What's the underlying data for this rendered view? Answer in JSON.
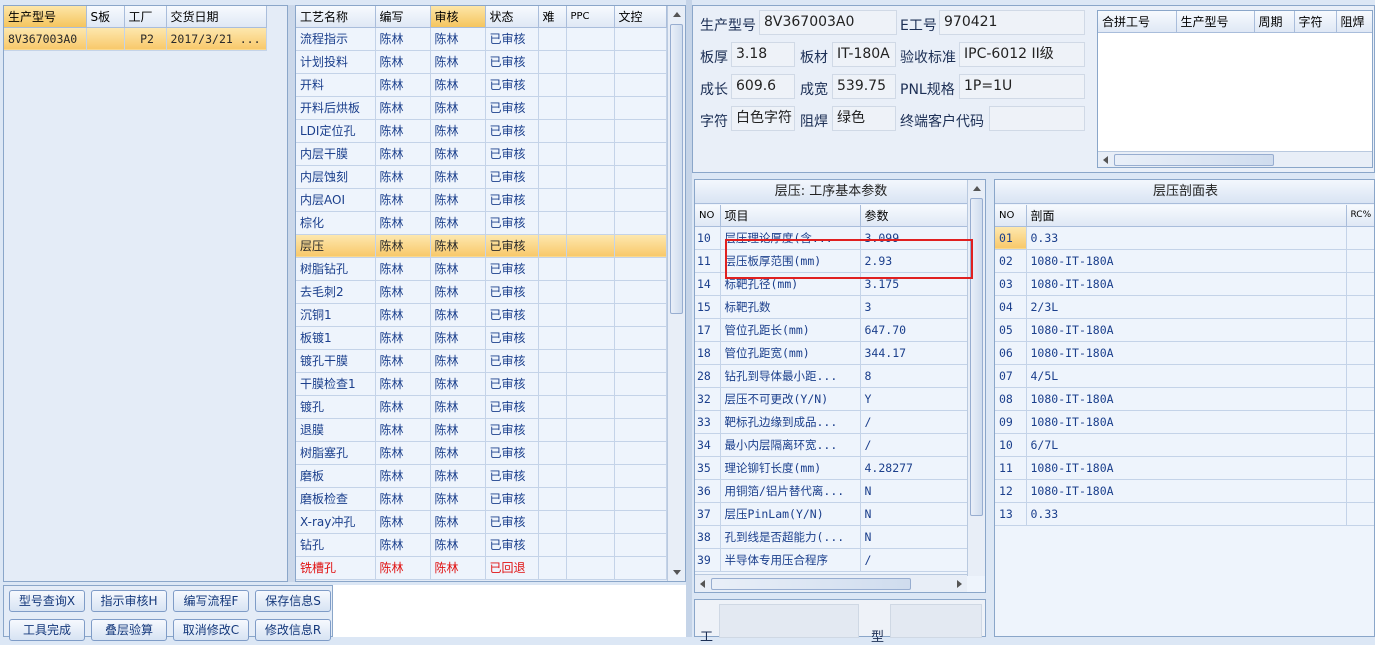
{
  "model_list": {
    "headers": [
      "生产型号",
      "S板",
      "工厂",
      "交货日期"
    ],
    "rows": [
      [
        "8V367003A0",
        "",
        "P2",
        "2017/3/21 ..."
      ]
    ]
  },
  "process_list": {
    "headers": [
      "工艺名称",
      "编写",
      "审核",
      "状态",
      "难",
      "PPC",
      "文控"
    ],
    "rows": [
      [
        "流程指示",
        "陈林",
        "陈林",
        "已审核"
      ],
      [
        "计划投料",
        "陈林",
        "陈林",
        "已审核"
      ],
      [
        "开料",
        "陈林",
        "陈林",
        "已审核"
      ],
      [
        "开料后烘板",
        "陈林",
        "陈林",
        "已审核"
      ],
      [
        "LDI定位孔",
        "陈林",
        "陈林",
        "已审核"
      ],
      [
        "内层干膜",
        "陈林",
        "陈林",
        "已审核"
      ],
      [
        "内层蚀刻",
        "陈林",
        "陈林",
        "已审核"
      ],
      [
        "内层AOI",
        "陈林",
        "陈林",
        "已审核"
      ],
      [
        "棕化",
        "陈林",
        "陈林",
        "已审核"
      ],
      [
        "层压",
        "陈林",
        "陈林",
        "已审核"
      ],
      [
        "树脂钻孔",
        "陈林",
        "陈林",
        "已审核"
      ],
      [
        "去毛刺2",
        "陈林",
        "陈林",
        "已审核"
      ],
      [
        "沉铜1",
        "陈林",
        "陈林",
        "已审核"
      ],
      [
        "板镀1",
        "陈林",
        "陈林",
        "已审核"
      ],
      [
        "镀孔干膜",
        "陈林",
        "陈林",
        "已审核"
      ],
      [
        "干膜检查1",
        "陈林",
        "陈林",
        "已审核"
      ],
      [
        "镀孔",
        "陈林",
        "陈林",
        "已审核"
      ],
      [
        "退膜",
        "陈林",
        "陈林",
        "已审核"
      ],
      [
        "树脂塞孔",
        "陈林",
        "陈林",
        "已审核"
      ],
      [
        "磨板",
        "陈林",
        "陈林",
        "已审核"
      ],
      [
        "磨板检查",
        "陈林",
        "陈林",
        "已审核"
      ],
      [
        "X-ray冲孔",
        "陈林",
        "陈林",
        "已审核"
      ],
      [
        "钻孔",
        "陈林",
        "陈林",
        "已审核"
      ],
      [
        "铣槽孔",
        "陈林",
        "陈林",
        "已回退"
      ]
    ]
  },
  "info": {
    "labels": {
      "model": "生产型号",
      "e_no": "E工号",
      "thickness": "板厚",
      "material": "板材",
      "standard": "验收标准",
      "length": "成长",
      "width": "成宽",
      "pnl": "PNL规格",
      "char": "字符",
      "mask": "阻焊",
      "customer": "终端客户代码"
    },
    "values": {
      "model": "8V367003A0",
      "e_no": "970421",
      "thickness": "3.18",
      "material": "IT-180A",
      "standard": "IPC-6012 II级",
      "length": "609.6",
      "width": "539.75",
      "pnl": "1P=1U",
      "char": "白色字符",
      "mask": "绿色",
      "customer": ""
    }
  },
  "merge_table": {
    "headers": [
      "合拼工号",
      "生产型号",
      "周期",
      "字符",
      "阻焊"
    ]
  },
  "params": {
    "title": "层压: 工序基本参数",
    "headers": [
      "NO",
      "项目",
      "参数"
    ],
    "rows": [
      [
        "10",
        "层压理论厚度(含...",
        "3.099"
      ],
      [
        "11",
        "层压板厚范围(mm)",
        "2.93"
      ],
      [
        "14",
        "标靶孔径(mm)",
        "3.175"
      ],
      [
        "15",
        "标靶孔数",
        "3"
      ],
      [
        "17",
        "管位孔距长(mm)",
        "647.70"
      ],
      [
        "18",
        "管位孔距宽(mm)",
        "344.17"
      ],
      [
        "28",
        "钻孔到导体最小距...",
        "8"
      ],
      [
        "32",
        "层压不可更改(Y/N)",
        "Y"
      ],
      [
        "33",
        "靶标孔边缘到成品...",
        "/"
      ],
      [
        "34",
        "最小内层隔离环宽...",
        "/"
      ],
      [
        "35",
        "理论铆钉长度(mm)",
        "4.28277"
      ],
      [
        "36",
        "用铜箔/铝片替代离...",
        "N"
      ],
      [
        "37",
        "层压PinLam(Y/N)",
        "N"
      ],
      [
        "38",
        "孔到线是否超能力(...",
        "N"
      ],
      [
        "39",
        "半导体专用压合程序",
        "/"
      ]
    ]
  },
  "stack": {
    "title": "层压剖面表",
    "headers": [
      "NO",
      "剖面",
      "RC%"
    ],
    "rows": [
      [
        "01",
        "0.33"
      ],
      [
        "02",
        "1080-IT-180A"
      ],
      [
        "03",
        "1080-IT-180A"
      ],
      [
        "04",
        "2/3L"
      ],
      [
        "05",
        "1080-IT-180A"
      ],
      [
        "06",
        "1080-IT-180A"
      ],
      [
        "07",
        "4/5L"
      ],
      [
        "08",
        "1080-IT-180A"
      ],
      [
        "09",
        "1080-IT-180A"
      ],
      [
        "10",
        "6/7L"
      ],
      [
        "11",
        "1080-IT-180A"
      ],
      [
        "12",
        "1080-IT-180A"
      ],
      [
        "13",
        "0.33"
      ]
    ]
  },
  "buttons": {
    "query": "型号查询X",
    "approve": "指示审核H",
    "edit_flow": "编写流程F",
    "save": "保存信息S",
    "done": "工具完成",
    "stack_check": "叠层验算",
    "cancel": "取消修改C",
    "modify": "修改信息R"
  },
  "bottom_labels": {
    "left": "工",
    "right": "型"
  },
  "colors": {
    "highlight_box": "#e02020",
    "selected_row": "#f8c86a",
    "rejected_text": "#e01010"
  }
}
